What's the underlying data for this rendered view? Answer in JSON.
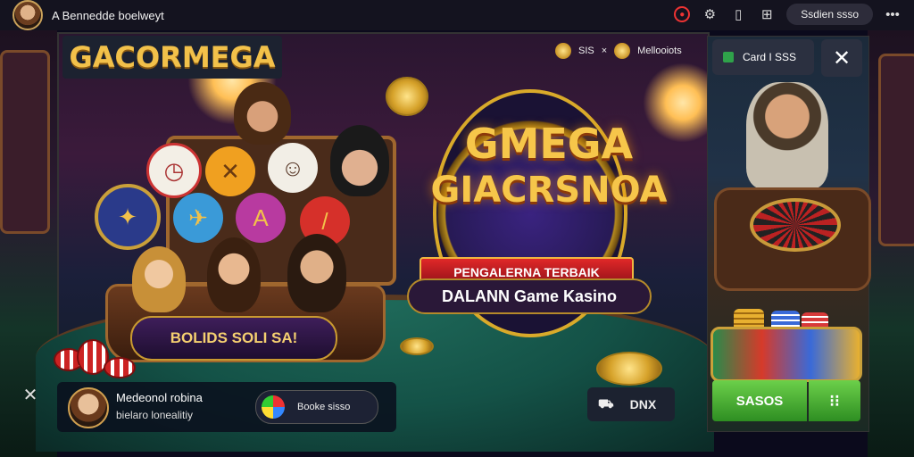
{
  "topbar": {
    "title": "A Bennedde boelweyt",
    "pill_label": "Ssdien ssso",
    "icons": [
      "record-icon",
      "gear-icon",
      "phone-icon",
      "grid-icon",
      "more-icon"
    ]
  },
  "banner": {
    "logo": "GACORMEGA",
    "headline_line1": "GMEGA",
    "headline_line2": "GIACRSNOA",
    "ribbon_line1": "PENGALERNA TERBAIK",
    "ribbon_line2": "DALANN Game Kasino",
    "bonus_label": "BOLIDS SOLI SA!",
    "top_right_left": "SIS",
    "top_right_sep": "×",
    "top_right_right": "Mellooiots"
  },
  "bottom": {
    "name": "Medeonol robina",
    "subtitle": "bielaro lonealitiy",
    "chip_label": "Booke sisso",
    "dnx_label": "DNX"
  },
  "side_panel": {
    "card_label": "Card I SSS",
    "primary_btn": "SASOS",
    "secondary_btn": "⁝⁝"
  },
  "colors": {
    "accent_gold": "#f2c14a",
    "accent_red": "#e02828",
    "accent_green": "#2fa24a"
  }
}
